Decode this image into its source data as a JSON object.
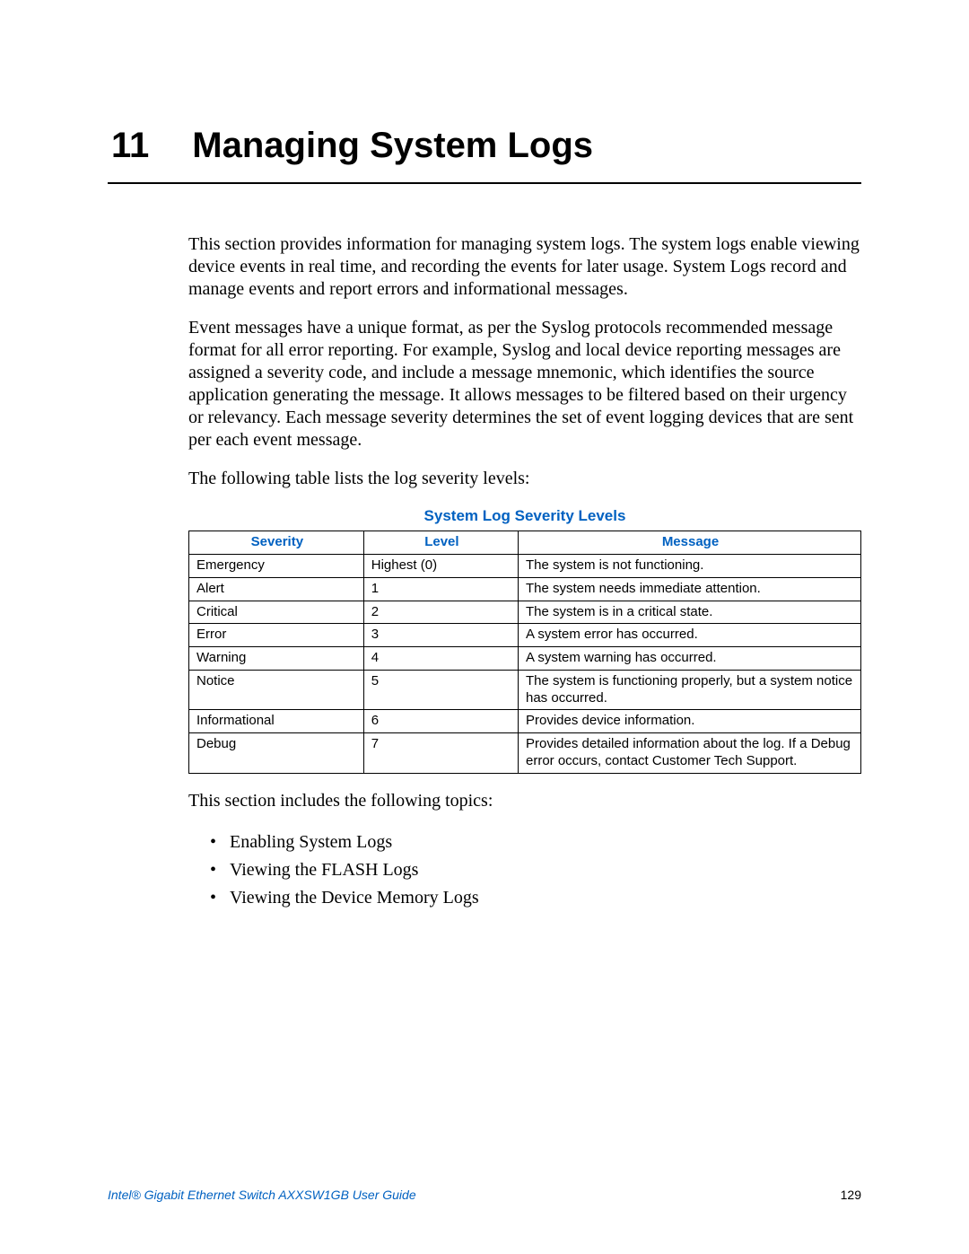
{
  "chapter": {
    "number": "11",
    "title": "Managing System Logs"
  },
  "paragraphs": {
    "p1": "This section provides information for managing system logs. The system logs enable viewing device events in real time, and recording the events for later usage. System Logs record and manage events and report errors and informational messages.",
    "p2": "Event messages have a unique format, as per the Syslog protocols recommended message format for all error reporting. For example, Syslog and local device reporting messages are assigned a severity code, and include a message mnemonic, which identifies the source application generating the message. It allows messages to be filtered based on their urgency or relevancy. Each message severity determines the set of event logging devices that are sent per each event message.",
    "p3": "The following table lists the log severity levels:",
    "p4": "This section includes the following topics:"
  },
  "table": {
    "title": "System Log Severity Levels",
    "headers": {
      "c1": "Severity",
      "c2": "Level",
      "c3": "Message"
    },
    "rows": [
      {
        "severity": "Emergency",
        "level": "Highest (0)",
        "message": "The system is not functioning."
      },
      {
        "severity": "Alert",
        "level": "1",
        "message": "The system needs immediate attention."
      },
      {
        "severity": "Critical",
        "level": "2",
        "message": "The system is in a critical state."
      },
      {
        "severity": "Error",
        "level": "3",
        "message": "A system error has occurred."
      },
      {
        "severity": "Warning",
        "level": "4",
        "message": "A system warning has occurred."
      },
      {
        "severity": "Notice",
        "level": "5",
        "message": "The system is functioning properly, but a system notice has occurred."
      },
      {
        "severity": "Informational",
        "level": "6",
        "message": "Provides device information."
      },
      {
        "severity": "Debug",
        "level": "7",
        "message": "Provides detailed information about the log. If a Debug error occurs, contact Customer Tech Support."
      }
    ]
  },
  "topics": [
    "Enabling System Logs",
    "Viewing the FLASH Logs",
    "Viewing the Device Memory Logs"
  ],
  "footer": {
    "guide": "Intel® Gigabit Ethernet Switch AXXSW1GB User Guide",
    "page": "129"
  }
}
